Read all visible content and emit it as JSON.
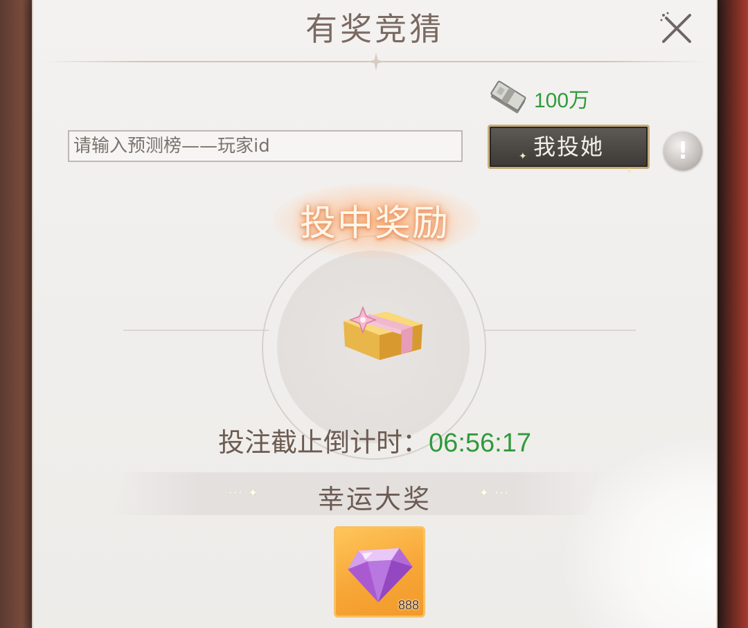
{
  "dialog": {
    "title": "有奖竞猜",
    "close_icon": "close-icon"
  },
  "currency": {
    "icon": "cash-bundle-icon",
    "amount": "100万"
  },
  "guess": {
    "input_placeholder": "请输入预测榜——玩家id",
    "input_value": "",
    "vote_button_label": "我投她",
    "info_button_label": "!"
  },
  "reward": {
    "title": "投中奖励",
    "icon": "gift-box-icon"
  },
  "countdown": {
    "label": "投注截止倒计时：",
    "value": "06:56:17"
  },
  "prize": {
    "title": "幸运大奖",
    "item_icon": "diamond-icon",
    "item_count": "888"
  },
  "colors": {
    "accent_green": "#2f9a3c",
    "text_brown": "#6c5b52",
    "slot_orange": "#f7a637"
  }
}
